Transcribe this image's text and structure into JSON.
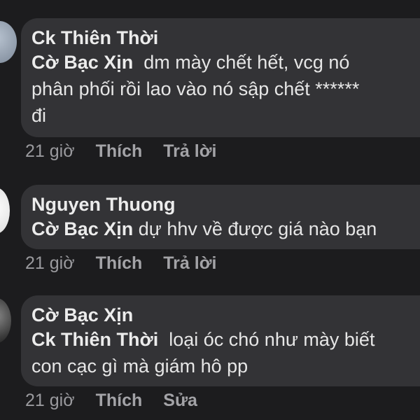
{
  "comments": [
    {
      "author": "Ck Thiên Thời",
      "mention": "Cờ Bạc Xịn",
      "text": "dm mày chết hết, vcg nó\nphân phối rồi lao vào nó sập chết ******\nđi",
      "time": "21 giờ",
      "like_label": "Thích",
      "second_action": "Trả lời"
    },
    {
      "author": "Nguyen Thuong",
      "mention": "Cờ Bạc Xịn",
      "text": "dự hhv về được giá nào bạn",
      "time": "21 giờ",
      "like_label": "Thích",
      "second_action": "Trả lời"
    },
    {
      "author": "Cờ Bạc Xịn",
      "mention": "Ck Thiên Thời",
      "text": "loại óc chó như mày biết\ncon cạc gì mà giám hô pp",
      "time": "21 giờ",
      "like_label": "Thích",
      "second_action": "Sửa"
    }
  ]
}
